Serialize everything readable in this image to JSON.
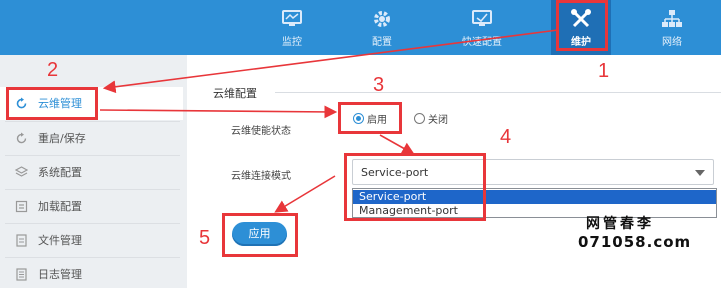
{
  "topnav": {
    "items": [
      {
        "label": "监控",
        "icon": "monitor-icon"
      },
      {
        "label": "配置",
        "icon": "gear-icon"
      },
      {
        "label": "快速配置",
        "icon": "quick-config-icon"
      },
      {
        "label": "维护",
        "icon": "tools-icon",
        "active": true
      },
      {
        "label": "网络",
        "icon": "network-icon"
      }
    ]
  },
  "sidebar": {
    "items": [
      {
        "label": "云维管理",
        "icon": "refresh-icon",
        "active": true
      },
      {
        "label": "重启/保存",
        "icon": "restart-icon"
      },
      {
        "label": "系统配置",
        "icon": "layers-icon"
      },
      {
        "label": "加载配置",
        "icon": "load-icon"
      },
      {
        "label": "文件管理",
        "icon": "file-icon"
      },
      {
        "label": "日志管理",
        "icon": "log-icon"
      }
    ]
  },
  "main": {
    "section_title": "云维配置",
    "enable_label": "云维使能状态",
    "radio_on": "启用",
    "radio_off": "关闭",
    "mode_label": "云维连接模式",
    "mode_value": "Service-port",
    "mode_options": [
      "Service-port",
      "Management-port"
    ],
    "apply_label": "应用"
  },
  "annotations": [
    "1",
    "2",
    "3",
    "4",
    "5"
  ],
  "watermark": {
    "line1": "网管春李",
    "line2": "071058.com"
  },
  "colors": {
    "nav": "#2d8fd6",
    "nav_active": "#1f6fb5",
    "annotation": "#e8363a",
    "selected": "#1e66c9"
  }
}
